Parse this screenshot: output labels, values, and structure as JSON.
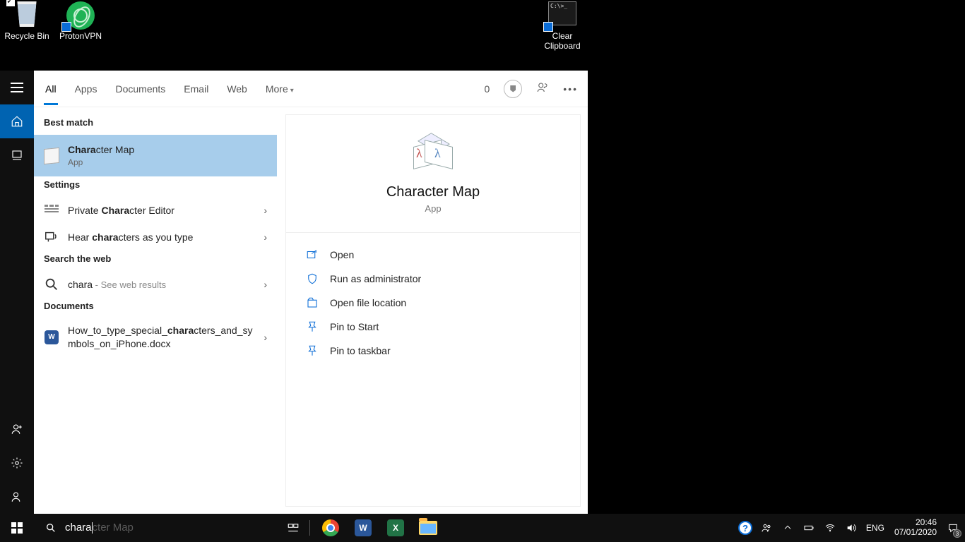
{
  "desktop": {
    "icons": [
      {
        "name": "recycle-bin",
        "label": "Recycle Bin"
      },
      {
        "name": "protonvpn",
        "label": "ProtonVPN"
      },
      {
        "name": "clear-clipboard",
        "label": "Clear Clipboard"
      }
    ]
  },
  "search": {
    "tabs": {
      "all": "All",
      "apps": "Apps",
      "documents": "Documents",
      "email": "Email",
      "web": "Web",
      "more": "More"
    },
    "rewards_count": "0",
    "sections": {
      "best_match": "Best match",
      "settings": "Settings",
      "search_web": "Search the web",
      "documents": "Documents"
    },
    "best": {
      "pre": "Chara",
      "match": "cter Map",
      "sub": "App"
    },
    "settings_items": {
      "pce_pre": "Private ",
      "pce_b": "Chara",
      "pce_post": "cter Editor",
      "hear_pre": "Hear ",
      "hear_b": "chara",
      "hear_post": "cters as you type"
    },
    "web": {
      "term": "chara",
      "hint": " - See web results"
    },
    "doc": {
      "pre": "How_to_type_special_",
      "b": "chara",
      "post": "cters_and_symbols_on_iPhone.docx"
    },
    "preview": {
      "title": "Character Map",
      "sub": "App"
    },
    "actions": {
      "open": "Open",
      "run_admin": "Run as administrator",
      "open_loc": "Open file location",
      "pin_start": "Pin to Start",
      "pin_taskbar": "Pin to taskbar"
    },
    "input": {
      "typed": "chara",
      "ghost": "cter Map"
    }
  },
  "tray": {
    "lang": "ENG",
    "time": "20:46",
    "date": "07/01/2020",
    "notif_count": "3"
  }
}
